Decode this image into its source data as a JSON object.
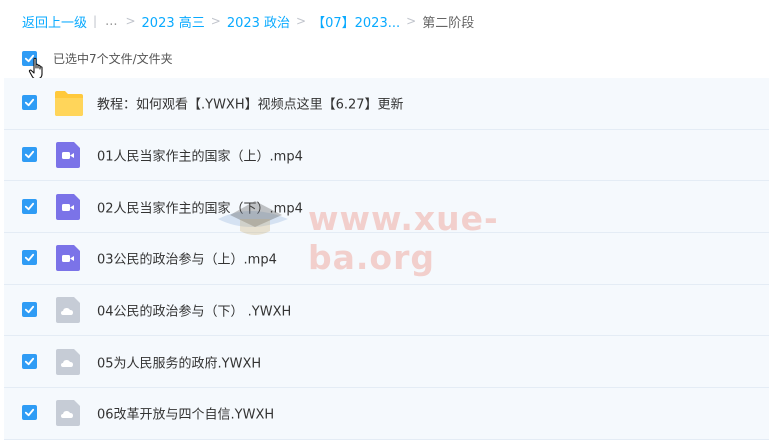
{
  "breadcrumb": {
    "back": "返回上一级",
    "ellipsis": "...",
    "items": [
      "2023 高三",
      "2023 政治",
      "【07】2023..."
    ],
    "current": "第二阶段"
  },
  "selection": {
    "label": "已选中7个文件/文件夹",
    "checked": true
  },
  "files": [
    {
      "name": "教程：如何观看【.YWXH】视频点这里【6.27】更新",
      "type": "folder",
      "checked": true
    },
    {
      "name": "01人民当家作主的国家（上）.mp4",
      "type": "video",
      "checked": true
    },
    {
      "name": "02人民当家作主的国家（下）.mp4",
      "type": "video",
      "checked": true
    },
    {
      "name": "03公民的政治参与（上）.mp4",
      "type": "video",
      "checked": true
    },
    {
      "name": "04公民的政治参与（下） .YWXH",
      "type": "unknown",
      "checked": true
    },
    {
      "name": "05为人民服务的政府.YWXH",
      "type": "unknown",
      "checked": true
    },
    {
      "name": "06改革开放与四个自信.YWXH",
      "type": "unknown",
      "checked": true
    }
  ],
  "watermark": {
    "text": "www.xue-ba.org"
  },
  "colors": {
    "accent": "#2f9cf5",
    "link": "#09aaff",
    "folder": "#ffc93c",
    "video": "#7b73e8",
    "unknown": "#c6ccd6",
    "row_bg": "#f5f9fd"
  }
}
